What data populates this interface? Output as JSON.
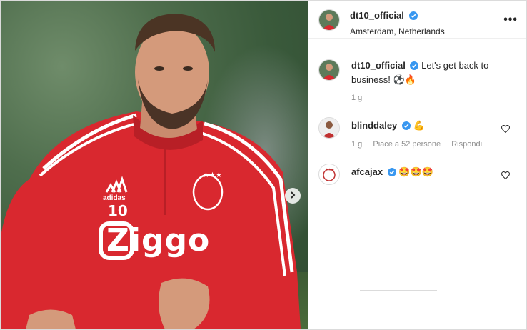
{
  "post": {
    "author": "dt10_official",
    "location": "Amsterdam, Netherlands",
    "more_label": "•••",
    "jersey_number": "10",
    "sponsor": "Ziggo"
  },
  "caption": {
    "username": "dt10_official",
    "text": "Let's get back to business! ⚽🔥",
    "time": "1 g"
  },
  "comments": [
    {
      "username": "blinddaley",
      "text": "💪",
      "time": "1 g",
      "likes": "Piace a 52 persone",
      "reply": "Rispondi"
    },
    {
      "username": "afcajax",
      "text": "🤩🤩🤩"
    }
  ],
  "colors": {
    "verified": "#3897f0",
    "jersey": "#d9282f"
  }
}
